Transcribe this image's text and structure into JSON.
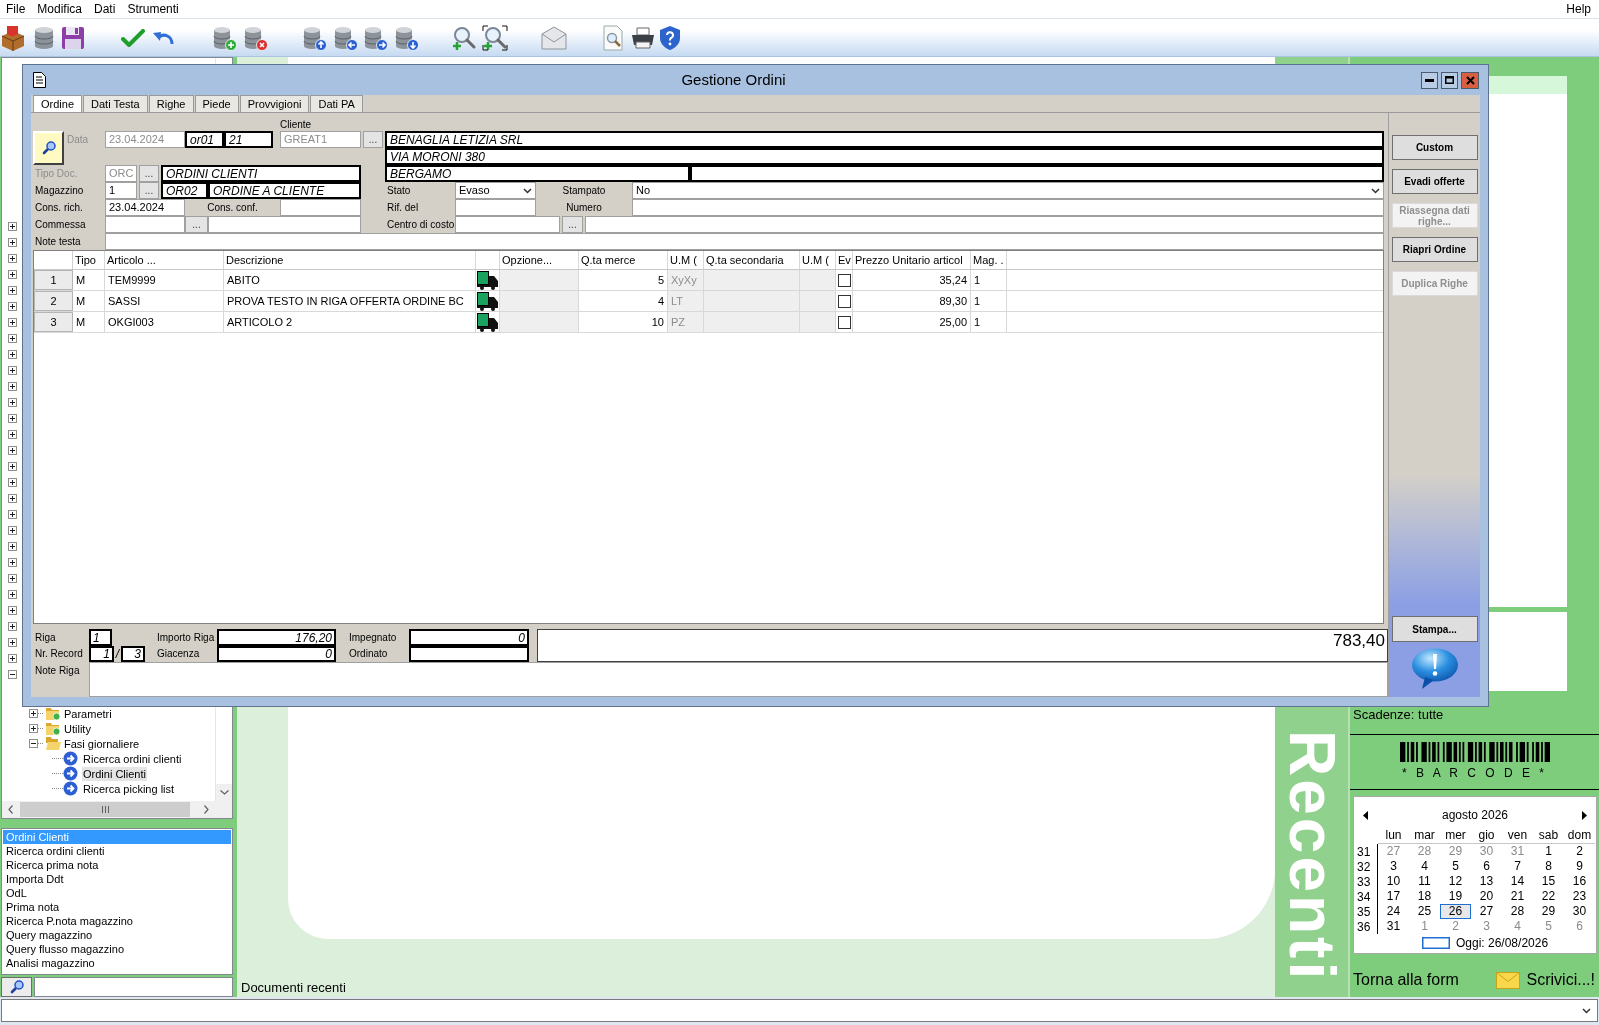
{
  "menu_bar": {
    "items": [
      "File",
      "Modifica",
      "Dati",
      "Strumenti"
    ],
    "help": "Help"
  },
  "sidebar": {
    "tree": {
      "items": [
        {
          "expanded": false
        },
        {
          "expanded": false
        },
        {
          "expanded": false
        },
        {
          "expanded": false
        },
        {
          "expanded": false
        },
        {
          "expanded": false
        },
        {
          "expanded": false
        },
        {
          "expanded": false
        },
        {
          "expanded": false
        },
        {
          "expanded": false
        },
        {
          "expanded": false
        },
        {
          "expanded": false
        },
        {
          "expanded": false
        },
        {
          "expanded": false
        },
        {
          "expanded": false
        },
        {
          "expanded": false
        },
        {
          "expanded": false
        },
        {
          "expanded": false
        },
        {
          "expanded": false
        },
        {
          "expanded": false
        },
        {
          "expanded": false
        },
        {
          "expanded": false
        },
        {
          "expanded": false
        },
        {
          "expanded": false
        },
        {
          "expanded": false
        },
        {
          "expanded": false
        },
        {
          "expanded": false
        },
        {
          "expanded": false
        },
        {
          "expanded": true,
          "children": [
            {
              "label": "Parametri",
              "expanded": false
            },
            {
              "label": "Utility",
              "expanded": false
            },
            {
              "label": "Fasi giornaliere",
              "expanded": true,
              "children": [
                {
                  "label": "Ricerca ordini clienti",
                  "selected": false
                },
                {
                  "label": "Ordini Clienti",
                  "selected": true
                },
                {
                  "label": "Ricerca picking list",
                  "selected": false
                }
              ]
            }
          ]
        }
      ]
    },
    "list": {
      "items": [
        {
          "label": "Ordini Clienti",
          "selected": true
        },
        {
          "label": "Ricerca ordini clienti",
          "selected": false
        },
        {
          "label": "Ricerca prima nota",
          "selected": false
        },
        {
          "label": "Importa Ddt",
          "selected": false
        },
        {
          "label": "OdL",
          "selected": false
        },
        {
          "label": "Prima nota",
          "selected": false
        },
        {
          "label": "Ricerca P.nota magazzino",
          "selected": false
        },
        {
          "label": "Query magazzino",
          "selected": false
        },
        {
          "label": "Query flusso magazzino",
          "selected": false
        },
        {
          "label": "Analisi magazzino",
          "selected": false
        }
      ]
    }
  },
  "recent_documents": {
    "title": "Documenti recenti",
    "banner": "Recenti"
  },
  "right_panel": {
    "scadenze": "Scadenze: tutte",
    "barcode_caption": "* B A R C O D E *",
    "calendar": {
      "month": "agosto 2026",
      "weekdays": [
        "lun",
        "mar",
        "mer",
        "gio",
        "ven",
        "sab",
        "dom"
      ],
      "weeks": [
        {
          "number": "31",
          "days": [
            {
              "day": "27",
              "other_month": true,
              "selected": false
            },
            {
              "day": "28",
              "other_month": true,
              "selected": false
            },
            {
              "day": "29",
              "other_month": true,
              "selected": false
            },
            {
              "day": "30",
              "other_month": true,
              "selected": false
            },
            {
              "day": "31",
              "other_month": true,
              "selected": false
            },
            {
              "day": "1",
              "other_month": false,
              "selected": false
            },
            {
              "day": "2",
              "other_month": false,
              "selected": false
            }
          ]
        },
        {
          "number": "32",
          "days": [
            {
              "day": "3",
              "other_month": false,
              "selected": false
            },
            {
              "day": "4",
              "other_month": false,
              "selected": false
            },
            {
              "day": "5",
              "other_month": false,
              "selected": false
            },
            {
              "day": "6",
              "other_month": false,
              "selected": false
            },
            {
              "day": "7",
              "other_month": false,
              "selected": false
            },
            {
              "day": "8",
              "other_month": false,
              "selected": false
            },
            {
              "day": "9",
              "other_month": false,
              "selected": false
            }
          ]
        },
        {
          "number": "33",
          "days": [
            {
              "day": "10",
              "other_month": false,
              "selected": false
            },
            {
              "day": "11",
              "other_month": false,
              "selected": false
            },
            {
              "day": "12",
              "other_month": false,
              "selected": false
            },
            {
              "day": "13",
              "other_month": false,
              "selected": false
            },
            {
              "day": "14",
              "other_month": false,
              "selected": false
            },
            {
              "day": "15",
              "other_month": false,
              "selected": false
            },
            {
              "day": "16",
              "other_month": false,
              "selected": false
            }
          ]
        },
        {
          "number": "34",
          "days": [
            {
              "day": "17",
              "other_month": false,
              "selected": false
            },
            {
              "day": "18",
              "other_month": false,
              "selected": false
            },
            {
              "day": "19",
              "other_month": false,
              "selected": false
            },
            {
              "day": "20",
              "other_month": false,
              "selected": false
            },
            {
              "day": "21",
              "other_month": false,
              "selected": false
            },
            {
              "day": "22",
              "other_month": false,
              "selected": false
            },
            {
              "day": "23",
              "other_month": false,
              "selected": false
            }
          ]
        },
        {
          "number": "35",
          "days": [
            {
              "day": "24",
              "other_month": false,
              "selected": false
            },
            {
              "day": "25",
              "other_month": false,
              "selected": false
            },
            {
              "day": "26",
              "other_month": false,
              "selected": true
            },
            {
              "day": "27",
              "other_month": false,
              "selected": false
            },
            {
              "day": "28",
              "other_month": false,
              "selected": false
            },
            {
              "day": "29",
              "other_month": false,
              "selected": false
            },
            {
              "day": "30",
              "other_month": false,
              "selected": false
            }
          ]
        },
        {
          "number": "36",
          "days": [
            {
              "day": "31",
              "other_month": false,
              "selected": false
            },
            {
              "day": "1",
              "other_month": true,
              "selected": false
            },
            {
              "day": "2",
              "other_month": true,
              "selected": false
            },
            {
              "day": "3",
              "other_month": true,
              "selected": false
            },
            {
              "day": "4",
              "other_month": true,
              "selected": false
            },
            {
              "day": "5",
              "other_month": true,
              "selected": false
            },
            {
              "day": "6",
              "other_month": true,
              "selected": false
            }
          ]
        }
      ],
      "today": "Oggi: 26/08/2026"
    },
    "back_link": "Torna alla form",
    "write_link": "Scrivici...!"
  },
  "dialog": {
    "title": "Gestione Ordini",
    "tabs": [
      {
        "label": "Ordine",
        "selected": true
      },
      {
        "label": "Dati Testa",
        "selected": false
      },
      {
        "label": "Righe",
        "selected": false
      },
      {
        "label": "Piede",
        "selected": false
      },
      {
        "label": "Provvigioni",
        "selected": false
      },
      {
        "label": "Dati PA",
        "selected": false
      }
    ],
    "header": {
      "data": {
        "label": "Data",
        "value": "23.04.2024",
        "disabled": true
      },
      "serie": "or01",
      "numero": "21",
      "cliente": {
        "label": "Cliente",
        "code": "GREAT1",
        "disabled": true,
        "lookup": "...",
        "name": "BENAGLIA LETIZIA SRL",
        "address": "VIA MORONI 380",
        "city": "BERGAMO"
      },
      "tipo_doc": {
        "label": "Tipo Doc.",
        "code": "ORC",
        "disabled": true,
        "lookup": "...",
        "description": "ORDINI CLIENTI"
      },
      "magazzino": {
        "label": "Magazzino",
        "code": "1",
        "lookup": "...",
        "doc_code": "OR02",
        "description": "ORDINE A CLIENTE"
      },
      "cons_rich": {
        "label": "Cons. rich.",
        "value": "23.04.2024"
      },
      "cons_conf": {
        "label": "Cons. conf."
      },
      "commessa": {
        "label": "Commessa",
        "lookup": "..."
      },
      "stato": {
        "label": "Stato",
        "value": "Evaso"
      },
      "stampato": {
        "label": "Stampato",
        "value": "No"
      },
      "rif_del": {
        "label": "Rif. del"
      },
      "numero_rif": {
        "label": "Numero"
      },
      "centro_di_costo": {
        "label": "Centro di costo",
        "lookup": "..."
      },
      "note_testa": {
        "label": "Note testa"
      }
    },
    "grid": {
      "columns": [
        {
          "label": "Tipo",
          "kind": "text",
          "disabled": false
        },
        {
          "label": "Articolo ...",
          "kind": "text",
          "disabled": false
        },
        {
          "label": "Descrizione",
          "kind": "text",
          "disabled": false
        },
        {
          "kind": "icon",
          "disabled": false
        },
        {
          "label": "Opzione...",
          "kind": "text",
          "disabled": true
        },
        {
          "label": "Q.ta merce",
          "kind": "number",
          "disabled": false
        },
        {
          "label": "U.M (",
          "kind": "text",
          "disabled": true
        },
        {
          "label": "Q.ta secondaria",
          "kind": "number",
          "disabled": true
        },
        {
          "label": "U.M (",
          "kind": "text",
          "disabled": true
        },
        {
          "label": "Ev",
          "kind": "check",
          "disabled": false
        },
        {
          "label": "Prezzo Unitario articol",
          "kind": "number",
          "disabled": false
        },
        {
          "label": "Mag. .",
          "kind": "text",
          "disabled": false
        }
      ],
      "rows": [
        {
          "number": "1",
          "tipo": "M",
          "articolo": "TEM9999",
          "descrizione": "ABITO",
          "q_merce": "5",
          "um_1": "XyXy",
          "evaso": false,
          "prezzo": "35,24",
          "mag": "1"
        },
        {
          "number": "2",
          "tipo": "M",
          "articolo": "SASSI",
          "descrizione": "PROVA TESTO IN RIGA OFFERTA ORDINE BC",
          "q_merce": "4",
          "um_1": "LT",
          "evaso": false,
          "prezzo": "89,30",
          "mag": "1"
        },
        {
          "number": "3",
          "tipo": "M",
          "articolo": "OKGI003",
          "descrizione": "ARTICOLO 2",
          "q_merce": "10",
          "um_1": "PZ",
          "evaso": false,
          "prezzo": "25,00",
          "mag": "1"
        }
      ]
    },
    "footer": {
      "riga": {
        "label": "Riga",
        "value": "1"
      },
      "nr_record": {
        "label": "Nr. Record",
        "current": "1",
        "separator": "/",
        "total": "3"
      },
      "importo_riga": {
        "label": "Importo Riga",
        "value": "176,20"
      },
      "giacenza": {
        "label": "Giacenza",
        "value": "0"
      },
      "impegnato": {
        "label": "Impegnato",
        "value": "0"
      },
      "ordinato": {
        "label": "Ordinato"
      },
      "total": "783,40",
      "note_riga": {
        "label": "Note Riga"
      }
    },
    "actions": [
      {
        "label": "Custom",
        "disabled": false
      },
      {
        "label": "Evadi offerte",
        "disabled": false
      },
      {
        "label": "Riassegna dati righe...",
        "disabled": true
      },
      {
        "label": "Riapri Ordine",
        "disabled": false
      },
      {
        "label": "Duplica Righe",
        "disabled": true
      }
    ],
    "print_button": "Stampa..."
  }
}
